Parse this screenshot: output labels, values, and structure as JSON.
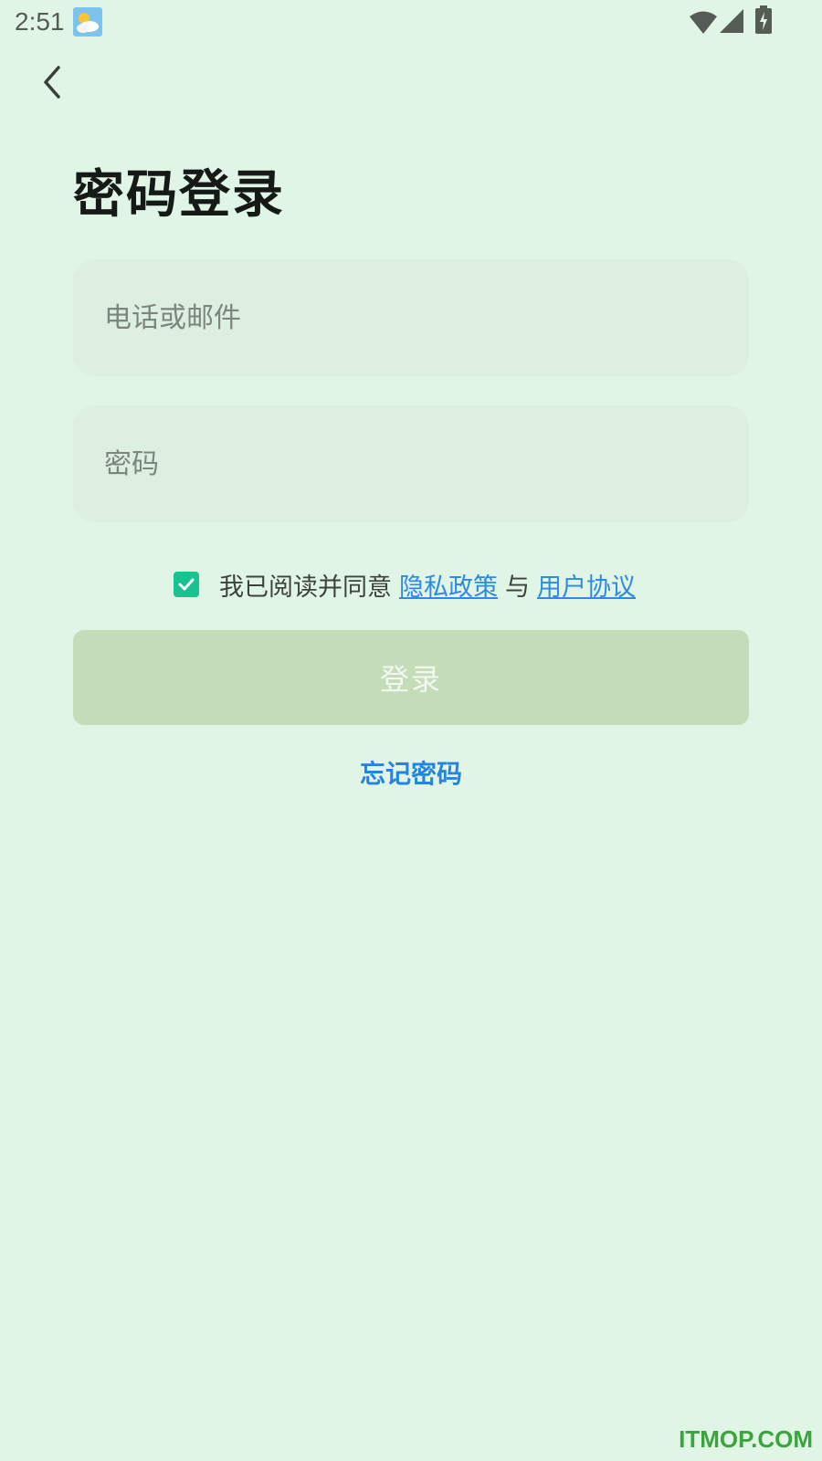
{
  "status_bar": {
    "time": "2:51",
    "weather_icon": "partly-cloudy-icon",
    "wifi_icon": "wifi-icon",
    "signal_icon": "signal-icon",
    "battery_icon": "battery-charging-icon"
  },
  "header": {
    "back_icon": "chevron-left-icon"
  },
  "page": {
    "title": "密码登录"
  },
  "form": {
    "account_placeholder": "电话或邮件",
    "password_placeholder": "密码"
  },
  "agreement": {
    "checked": true,
    "prefix": "我已阅读并同意",
    "privacy_link": "隐私政策",
    "conjunction": "与",
    "terms_link": "用户协议"
  },
  "actions": {
    "login_label": "登录",
    "forgot_label": "忘记密码"
  },
  "watermark": "ITMOP.COM",
  "colors": {
    "background": "#e1f5e6",
    "field_bg": "#dcefe0",
    "checkbox": "#19c38f",
    "link": "#2d8ae5",
    "login_button_disabled": "#c4ddb8",
    "watermark": "#3aa53c"
  }
}
